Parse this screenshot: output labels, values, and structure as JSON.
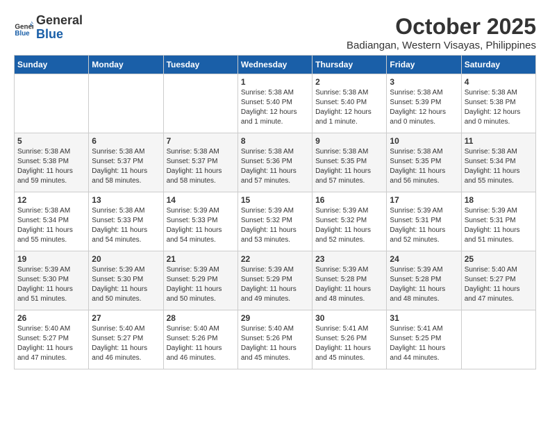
{
  "header": {
    "logo_general": "General",
    "logo_blue": "Blue",
    "month_title": "October 2025",
    "location": "Badiangan, Western Visayas, Philippines"
  },
  "weekdays": [
    "Sunday",
    "Monday",
    "Tuesday",
    "Wednesday",
    "Thursday",
    "Friday",
    "Saturday"
  ],
  "weeks": [
    [
      {
        "day": "",
        "info": ""
      },
      {
        "day": "",
        "info": ""
      },
      {
        "day": "",
        "info": ""
      },
      {
        "day": "1",
        "info": "Sunrise: 5:38 AM\nSunset: 5:40 PM\nDaylight: 12 hours\nand 1 minute."
      },
      {
        "day": "2",
        "info": "Sunrise: 5:38 AM\nSunset: 5:40 PM\nDaylight: 12 hours\nand 1 minute."
      },
      {
        "day": "3",
        "info": "Sunrise: 5:38 AM\nSunset: 5:39 PM\nDaylight: 12 hours\nand 0 minutes."
      },
      {
        "day": "4",
        "info": "Sunrise: 5:38 AM\nSunset: 5:38 PM\nDaylight: 12 hours\nand 0 minutes."
      }
    ],
    [
      {
        "day": "5",
        "info": "Sunrise: 5:38 AM\nSunset: 5:38 PM\nDaylight: 11 hours\nand 59 minutes."
      },
      {
        "day": "6",
        "info": "Sunrise: 5:38 AM\nSunset: 5:37 PM\nDaylight: 11 hours\nand 58 minutes."
      },
      {
        "day": "7",
        "info": "Sunrise: 5:38 AM\nSunset: 5:37 PM\nDaylight: 11 hours\nand 58 minutes."
      },
      {
        "day": "8",
        "info": "Sunrise: 5:38 AM\nSunset: 5:36 PM\nDaylight: 11 hours\nand 57 minutes."
      },
      {
        "day": "9",
        "info": "Sunrise: 5:38 AM\nSunset: 5:35 PM\nDaylight: 11 hours\nand 57 minutes."
      },
      {
        "day": "10",
        "info": "Sunrise: 5:38 AM\nSunset: 5:35 PM\nDaylight: 11 hours\nand 56 minutes."
      },
      {
        "day": "11",
        "info": "Sunrise: 5:38 AM\nSunset: 5:34 PM\nDaylight: 11 hours\nand 55 minutes."
      }
    ],
    [
      {
        "day": "12",
        "info": "Sunrise: 5:38 AM\nSunset: 5:34 PM\nDaylight: 11 hours\nand 55 minutes."
      },
      {
        "day": "13",
        "info": "Sunrise: 5:38 AM\nSunset: 5:33 PM\nDaylight: 11 hours\nand 54 minutes."
      },
      {
        "day": "14",
        "info": "Sunrise: 5:39 AM\nSunset: 5:33 PM\nDaylight: 11 hours\nand 54 minutes."
      },
      {
        "day": "15",
        "info": "Sunrise: 5:39 AM\nSunset: 5:32 PM\nDaylight: 11 hours\nand 53 minutes."
      },
      {
        "day": "16",
        "info": "Sunrise: 5:39 AM\nSunset: 5:32 PM\nDaylight: 11 hours\nand 52 minutes."
      },
      {
        "day": "17",
        "info": "Sunrise: 5:39 AM\nSunset: 5:31 PM\nDaylight: 11 hours\nand 52 minutes."
      },
      {
        "day": "18",
        "info": "Sunrise: 5:39 AM\nSunset: 5:31 PM\nDaylight: 11 hours\nand 51 minutes."
      }
    ],
    [
      {
        "day": "19",
        "info": "Sunrise: 5:39 AM\nSunset: 5:30 PM\nDaylight: 11 hours\nand 51 minutes."
      },
      {
        "day": "20",
        "info": "Sunrise: 5:39 AM\nSunset: 5:30 PM\nDaylight: 11 hours\nand 50 minutes."
      },
      {
        "day": "21",
        "info": "Sunrise: 5:39 AM\nSunset: 5:29 PM\nDaylight: 11 hours\nand 50 minutes."
      },
      {
        "day": "22",
        "info": "Sunrise: 5:39 AM\nSunset: 5:29 PM\nDaylight: 11 hours\nand 49 minutes."
      },
      {
        "day": "23",
        "info": "Sunrise: 5:39 AM\nSunset: 5:28 PM\nDaylight: 11 hours\nand 48 minutes."
      },
      {
        "day": "24",
        "info": "Sunrise: 5:39 AM\nSunset: 5:28 PM\nDaylight: 11 hours\nand 48 minutes."
      },
      {
        "day": "25",
        "info": "Sunrise: 5:40 AM\nSunset: 5:27 PM\nDaylight: 11 hours\nand 47 minutes."
      }
    ],
    [
      {
        "day": "26",
        "info": "Sunrise: 5:40 AM\nSunset: 5:27 PM\nDaylight: 11 hours\nand 47 minutes."
      },
      {
        "day": "27",
        "info": "Sunrise: 5:40 AM\nSunset: 5:27 PM\nDaylight: 11 hours\nand 46 minutes."
      },
      {
        "day": "28",
        "info": "Sunrise: 5:40 AM\nSunset: 5:26 PM\nDaylight: 11 hours\nand 46 minutes."
      },
      {
        "day": "29",
        "info": "Sunrise: 5:40 AM\nSunset: 5:26 PM\nDaylight: 11 hours\nand 45 minutes."
      },
      {
        "day": "30",
        "info": "Sunrise: 5:41 AM\nSunset: 5:26 PM\nDaylight: 11 hours\nand 45 minutes."
      },
      {
        "day": "31",
        "info": "Sunrise: 5:41 AM\nSunset: 5:25 PM\nDaylight: 11 hours\nand 44 minutes."
      },
      {
        "day": "",
        "info": ""
      }
    ]
  ]
}
